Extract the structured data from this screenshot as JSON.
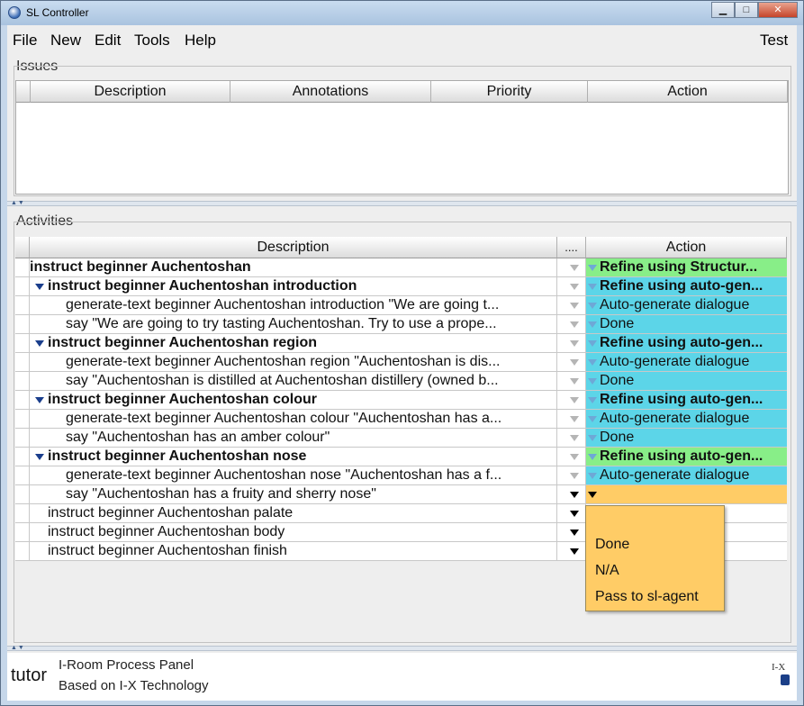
{
  "window": {
    "title": "SL Controller",
    "buttons": {
      "minimize": "▁",
      "maximize": "□",
      "close": "✕"
    }
  },
  "menubar": {
    "items": [
      "File",
      "New",
      "Edit",
      "Tools",
      "Help"
    ],
    "right_label": "Test"
  },
  "issues": {
    "label": "Issues",
    "columns": [
      "Description",
      "Annotations",
      "Priority",
      "Action"
    ]
  },
  "activities": {
    "label": "Activities",
    "columns": {
      "description": "Description",
      "dots": "....",
      "action": "Action"
    },
    "rows": [
      {
        "desc": "instruct beginner Auchentoshan",
        "bold": true,
        "indent": 0,
        "expander": true,
        "action": "Refine using Structur...",
        "action_bold": true,
        "action_color": "green",
        "dots": "gray"
      },
      {
        "desc": "instruct beginner Auchentoshan introduction",
        "bold": true,
        "indent": 1,
        "expander": true,
        "action": "Refine using auto-gen...",
        "action_bold": true,
        "action_color": "cyan",
        "dots": "gray"
      },
      {
        "desc": "generate-text beginner Auchentoshan introduction \"We are going t...",
        "bold": false,
        "indent": 2,
        "expander": false,
        "action": "Auto-generate dialogue",
        "action_bold": false,
        "action_color": "cyan",
        "dots": "gray"
      },
      {
        "desc": "say \"We are going to try tasting Auchentoshan. Try to use a prope...",
        "bold": false,
        "indent": 2,
        "expander": false,
        "action": "Done",
        "action_bold": false,
        "action_color": "cyan",
        "dots": "gray"
      },
      {
        "desc": "instruct beginner Auchentoshan region",
        "bold": true,
        "indent": 1,
        "expander": true,
        "action": "Refine using auto-gen...",
        "action_bold": true,
        "action_color": "cyan",
        "dots": "gray"
      },
      {
        "desc": "generate-text beginner Auchentoshan region \"Auchentoshan is dis...",
        "bold": false,
        "indent": 2,
        "expander": false,
        "action": "Auto-generate dialogue",
        "action_bold": false,
        "action_color": "cyan",
        "dots": "gray"
      },
      {
        "desc": "say \"Auchentoshan is distilled at Auchentoshan distillery (owned b...",
        "bold": false,
        "indent": 2,
        "expander": false,
        "action": "Done",
        "action_bold": false,
        "action_color": "cyan",
        "dots": "gray"
      },
      {
        "desc": "instruct beginner Auchentoshan colour",
        "bold": true,
        "indent": 1,
        "expander": true,
        "action": "Refine using auto-gen...",
        "action_bold": true,
        "action_color": "cyan",
        "dots": "gray"
      },
      {
        "desc": "generate-text beginner Auchentoshan colour \"Auchentoshan has a...",
        "bold": false,
        "indent": 2,
        "expander": false,
        "action": "Auto-generate dialogue",
        "action_bold": false,
        "action_color": "cyan",
        "dots": "gray"
      },
      {
        "desc": "say \"Auchentoshan has an amber colour\"",
        "bold": false,
        "indent": 2,
        "expander": false,
        "action": "Done",
        "action_bold": false,
        "action_color": "cyan",
        "dots": "gray"
      },
      {
        "desc": "instruct beginner Auchentoshan nose",
        "bold": true,
        "indent": 1,
        "expander": true,
        "action": "Refine using auto-gen...",
        "action_bold": true,
        "action_color": "green",
        "dots": "gray"
      },
      {
        "desc": "generate-text beginner Auchentoshan nose \"Auchentoshan has a f...",
        "bold": false,
        "indent": 2,
        "expander": false,
        "action": "Auto-generate dialogue",
        "action_bold": false,
        "action_color": "cyan",
        "dots": "gray"
      },
      {
        "desc": "say \"Auchentoshan has a fruity and sherry nose\"",
        "bold": false,
        "indent": 2,
        "expander": false,
        "action": "",
        "action_bold": false,
        "action_color": "orange",
        "dots": "black"
      },
      {
        "desc": "instruct beginner Auchentoshan palate",
        "bold": false,
        "indent": 1,
        "expander": false,
        "action": "",
        "action_bold": false,
        "action_color": "white",
        "dots": "black"
      },
      {
        "desc": "instruct beginner Auchentoshan body",
        "bold": false,
        "indent": 1,
        "expander": false,
        "action": "",
        "action_bold": false,
        "action_color": "white",
        "dots": "black"
      },
      {
        "desc": "instruct beginner Auchentoshan finish",
        "bold": false,
        "indent": 1,
        "expander": false,
        "action": "",
        "action_bold": false,
        "action_color": "white",
        "dots": "black"
      }
    ],
    "popup_options": [
      "Done",
      "N/A",
      "Pass to sl-agent"
    ]
  },
  "footer": {
    "agent_name": "tutor",
    "line1": "I-Room Process Panel",
    "line2": "Based on I-X Technology",
    "logo_text": "I-X"
  },
  "colors": {
    "green": "#88ee88",
    "cyan": "#5cd5e8",
    "orange": "#ffcc66",
    "white": "#ffffff"
  }
}
